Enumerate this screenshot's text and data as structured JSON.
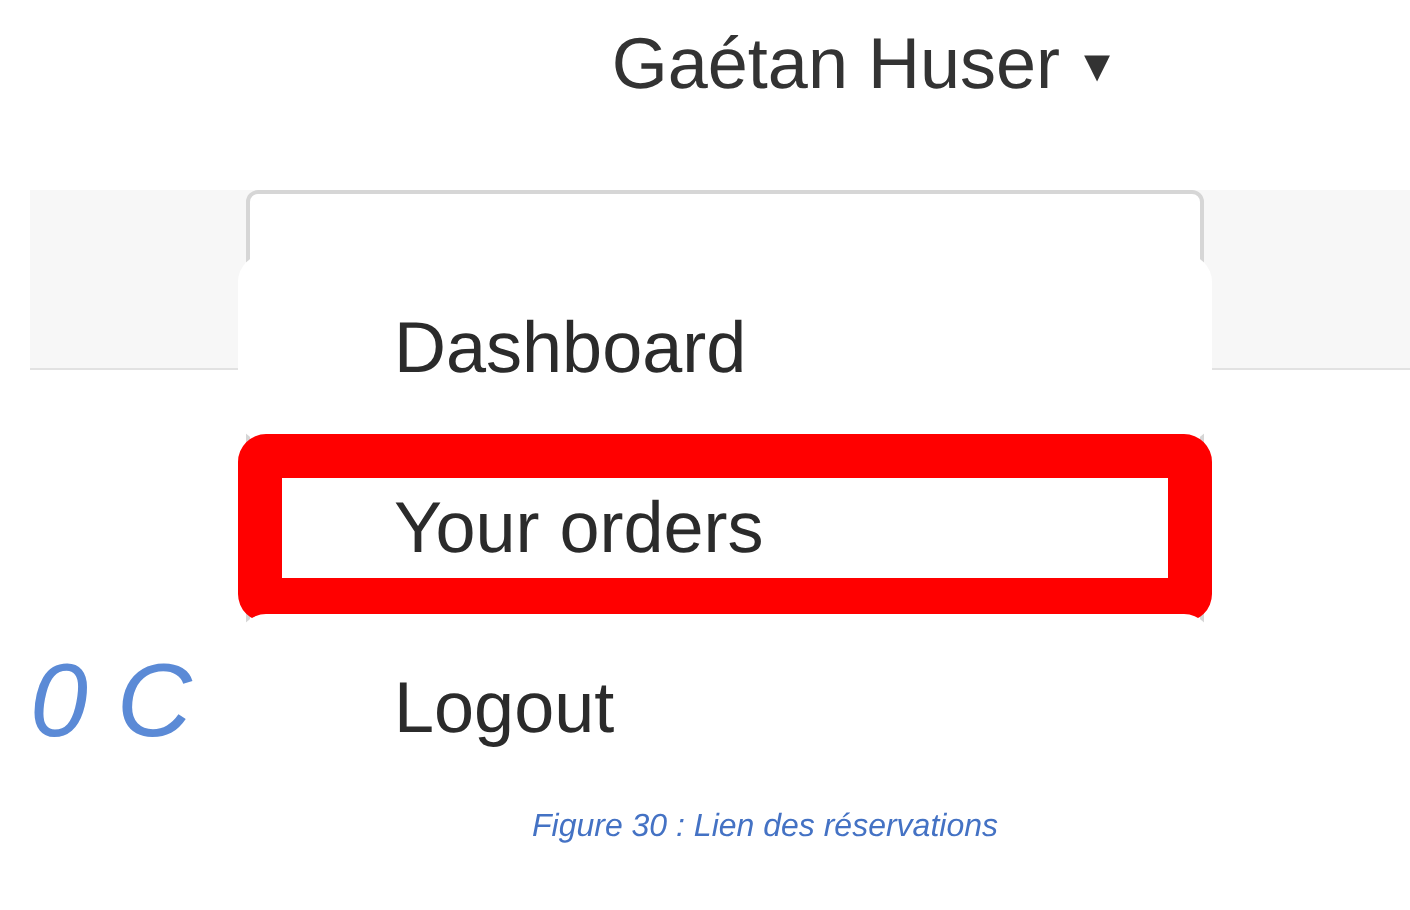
{
  "user_menu": {
    "name": "Gaétan Huser",
    "caret": "▾"
  },
  "background_text": "0 C",
  "dropdown": {
    "items": [
      {
        "label": "Dashboard",
        "highlighted": false
      },
      {
        "label": "Your orders",
        "highlighted": true
      },
      {
        "label": "Logout",
        "highlighted": false
      }
    ]
  },
  "caption": "Figure 30 : Lien des réservations"
}
